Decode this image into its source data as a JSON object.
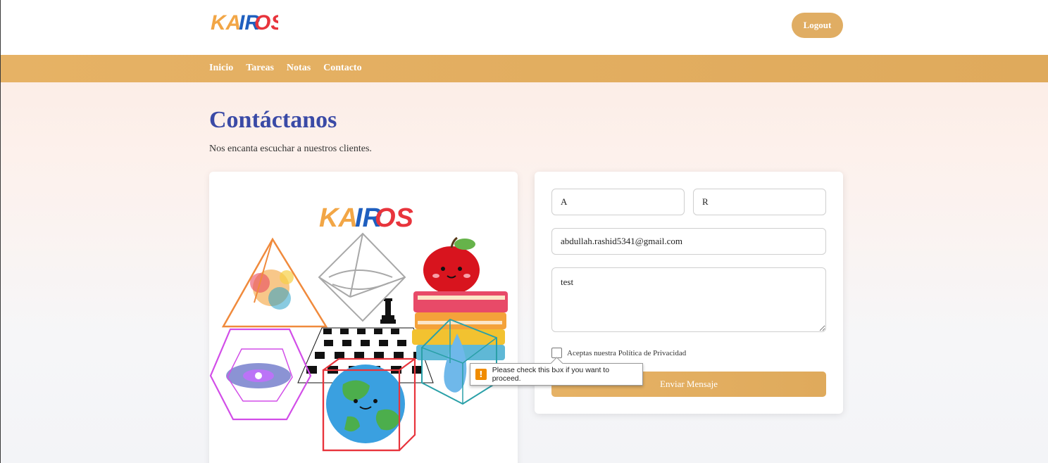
{
  "brand": {
    "logo_text_parts": [
      "KA",
      "IR",
      "OS"
    ],
    "colors": [
      "#f2a646",
      "#1f5fbf",
      "#e8343c"
    ]
  },
  "header": {
    "logout_label": "Logout"
  },
  "nav": {
    "items": [
      "Inicio",
      "Tareas",
      "Notas",
      "Contacto"
    ]
  },
  "page": {
    "title": "Contáctanos",
    "subtitle": "Nos encanta escuchar a nuestros clientes."
  },
  "form": {
    "first_name": "A",
    "last_name": "R",
    "email": "abdullah.rashid5341@gmail.com",
    "message": "test",
    "privacy_label": "Aceptas nuestra Política de Privacidad",
    "privacy_checked": false,
    "submit_label": "Enviar Mensaje"
  },
  "tooltip": {
    "text": "Please check this box if you want to proceed.",
    "icon": "warning-icon"
  },
  "colors": {
    "accent": "#e0ad63",
    "title": "#3a4aa6"
  }
}
